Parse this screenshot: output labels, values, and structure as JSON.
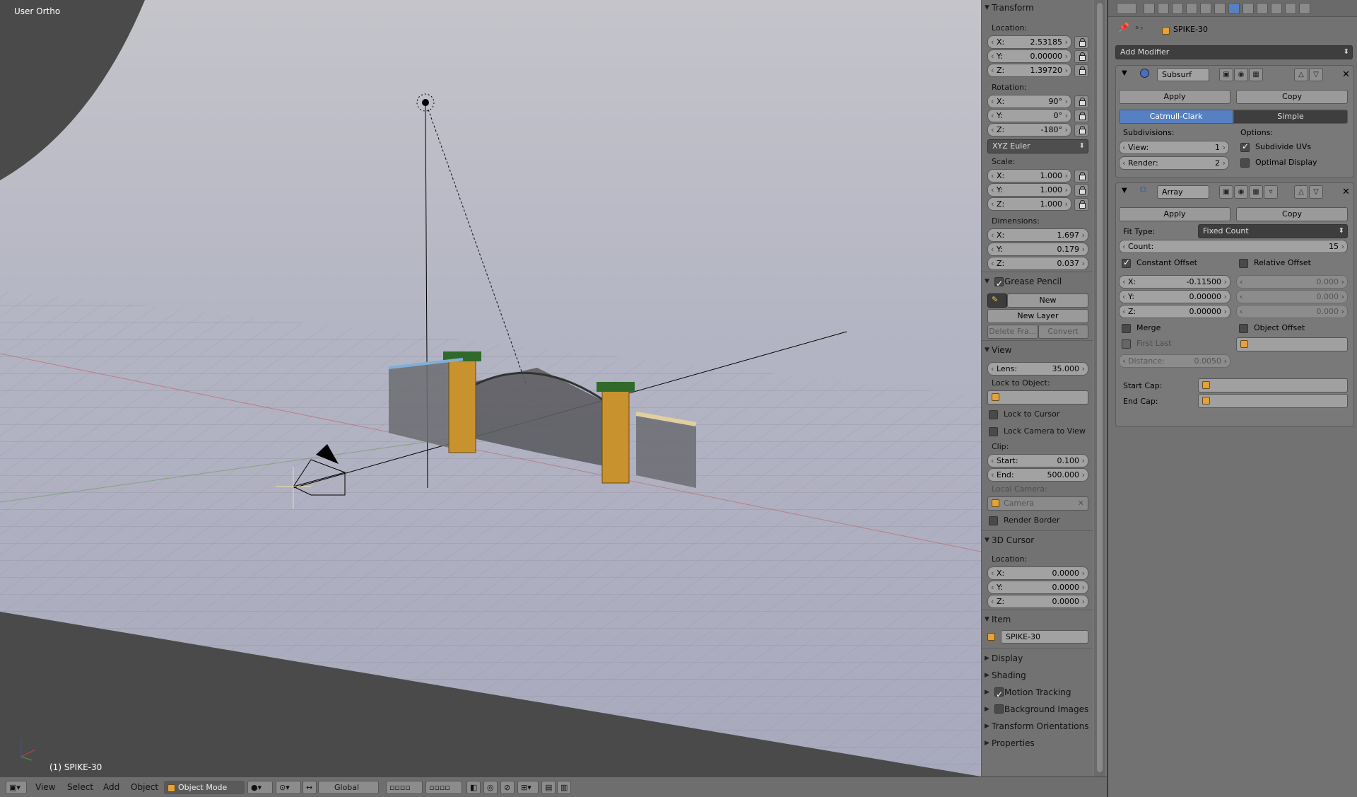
{
  "viewport": {
    "view_name": "User Ortho",
    "object_label": "(1) SPIKE-30"
  },
  "npanel": {
    "transform": {
      "title": "Transform",
      "location_label": "Location:",
      "location": [
        {
          "k": "X:",
          "v": "2.53185"
        },
        {
          "k": "Y:",
          "v": "0.00000"
        },
        {
          "k": "Z:",
          "v": "1.39720"
        }
      ],
      "rotation_label": "Rotation:",
      "rotation": [
        {
          "k": "X:",
          "v": "90°"
        },
        {
          "k": "Y:",
          "v": "0°"
        },
        {
          "k": "Z:",
          "v": "-180°"
        }
      ],
      "rotation_mode": "XYZ Euler",
      "scale_label": "Scale:",
      "scale": [
        {
          "k": "X:",
          "v": "1.000"
        },
        {
          "k": "Y:",
          "v": "1.000"
        },
        {
          "k": "Z:",
          "v": "1.000"
        }
      ],
      "dimensions_label": "Dimensions:",
      "dimensions": [
        {
          "k": "X:",
          "v": "1.697"
        },
        {
          "k": "Y:",
          "v": "0.179"
        },
        {
          "k": "Z:",
          "v": "0.037"
        }
      ]
    },
    "grease_pencil": {
      "title": "Grease Pencil",
      "new": "New",
      "new_layer": "New Layer",
      "delete_frame": "Delete Fra...",
      "convert": "Convert"
    },
    "view": {
      "title": "View",
      "lens_label": "Lens:",
      "lens": "35.000",
      "lock_to_object": "Lock to Object:",
      "lock_to_cursor": "Lock to Cursor",
      "lock_camera": "Lock Camera to View",
      "clip_label": "Clip:",
      "start_label": "Start:",
      "start": "0.100",
      "end_label": "End:",
      "end": "500.000",
      "local_camera": "Local Camera:",
      "camera": "Camera",
      "render_border": "Render Border"
    },
    "cursor": {
      "title": "3D Cursor",
      "location_label": "Location:",
      "location": [
        {
          "k": "X:",
          "v": "0.0000"
        },
        {
          "k": "Y:",
          "v": "0.0000"
        },
        {
          "k": "Z:",
          "v": "0.0000"
        }
      ]
    },
    "item": {
      "title": "Item",
      "name": "SPIKE-30"
    },
    "collapsed": [
      "Display",
      "Shading",
      "Motion Tracking",
      "Background Images",
      "Transform Orientations",
      "Properties"
    ]
  },
  "props": {
    "object_name": "SPIKE-30",
    "add_modifier": "Add Modifier",
    "subsurf": {
      "name": "Subsurf",
      "apply": "Apply",
      "copy": "Copy",
      "catmull": "Catmull-Clark",
      "simple": "Simple",
      "subdivisions": "Subdivisions:",
      "options": "Options:",
      "view_label": "View:",
      "view": "1",
      "render_label": "Render:",
      "render": "2",
      "subdivide_uvs": "Subdivide UVs",
      "optimal_display": "Optimal Display"
    },
    "array": {
      "name": "Array",
      "apply": "Apply",
      "copy": "Copy",
      "fit_type_label": "Fit Type:",
      "fit_type": "Fixed Count",
      "count_label": "Count:",
      "count": "15",
      "constant_offset": "Constant Offset",
      "relative_offset": "Relative Offset",
      "const": [
        {
          "k": "X:",
          "v": "-0.11500"
        },
        {
          "k": "Y:",
          "v": "0.00000"
        },
        {
          "k": "Z:",
          "v": "0.00000"
        }
      ],
      "rel": [
        {
          "k": "",
          "v": "0.000"
        },
        {
          "k": "",
          "v": "0.000"
        },
        {
          "k": "",
          "v": "0.000"
        }
      ],
      "merge": "Merge",
      "object_offset": "Object Offset",
      "first_last": "First Last",
      "distance_label": "Distance:",
      "distance": "0.0050",
      "start_cap": "Start Cap:",
      "end_cap": "End Cap:"
    }
  },
  "footer": {
    "menu": [
      "View",
      "Select",
      "Add",
      "Object"
    ],
    "mode": "Object Mode",
    "orientation": "Global"
  }
}
